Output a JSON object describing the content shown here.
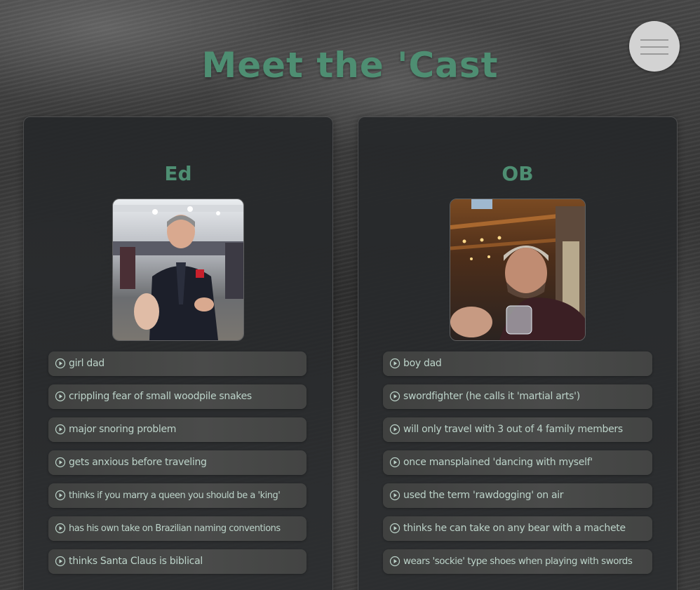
{
  "page": {
    "title": "Meet the 'Cast"
  },
  "menu": {
    "icon": "hamburger-menu-icon"
  },
  "colors": {
    "accent": "#4e8e72",
    "fact_text": "#bcd3c9",
    "menu_bg": "#d3d3d3"
  },
  "cast": [
    {
      "name": "Ed",
      "facts": [
        "girl dad",
        "crippling fear of small woodpile snakes",
        "major snoring problem",
        "gets anxious before traveling",
        "thinks if you marry a queen you should be a 'king'",
        "has his own take on Brazilian naming conventions",
        "thinks Santa Claus is biblical"
      ]
    },
    {
      "name": "OB",
      "facts": [
        "boy dad",
        "swordfighter (he calls it 'martial arts')",
        "will only travel with 3 out of 4 family members",
        "once mansplained 'dancing with myself'",
        "used the term 'rawdogging' on air",
        "thinks he can take on any bear with a machete",
        "wears 'sockie' type shoes when playing with swords"
      ]
    }
  ]
}
